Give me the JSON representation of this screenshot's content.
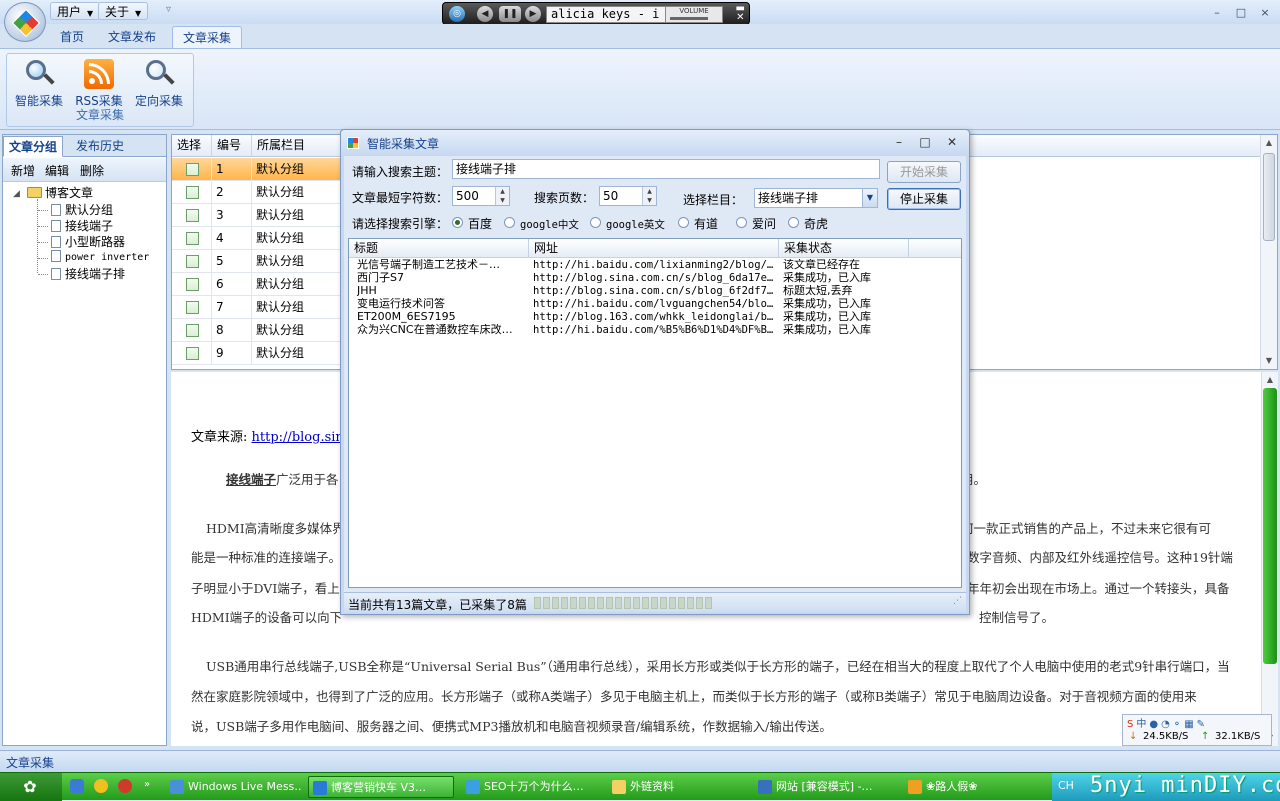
{
  "app": {
    "menus": [
      {
        "label": "用户"
      },
      {
        "label": "关于"
      }
    ],
    "window_controls": {
      "min": "–",
      "max": "□",
      "close": "×"
    }
  },
  "player": {
    "track": "alicia keys - i",
    "volume_label": "VOLUME",
    "volume_level": 0.75
  },
  "ribbon": {
    "tabs": [
      {
        "label": "首页"
      },
      {
        "label": "文章发布"
      },
      {
        "label": "文章采集"
      }
    ],
    "active_tab": "文章采集",
    "group_label": "文章采集",
    "buttons": [
      {
        "label": "智能采集",
        "icon": "magnifier-icon"
      },
      {
        "label": "RSS采集",
        "icon": "rss-icon"
      },
      {
        "label": "定向采集",
        "icon": "magnifier-icon"
      }
    ]
  },
  "left_panel": {
    "tabs": [
      {
        "label": "文章分组"
      },
      {
        "label": "发布历史"
      }
    ],
    "toolbar": [
      {
        "label": "新增"
      },
      {
        "label": "编辑"
      },
      {
        "label": "删除"
      }
    ],
    "tree": {
      "root": "博客文章",
      "children": [
        {
          "label": "默认分组"
        },
        {
          "label": "接线端子"
        },
        {
          "label": "小型断路器"
        },
        {
          "label": "power inverter"
        },
        {
          "label": "接线端子排"
        }
      ]
    }
  },
  "grid": {
    "columns": [
      "选择",
      "编号",
      "所属栏目"
    ],
    "rows": [
      {
        "id": "1",
        "group": "默认分组"
      },
      {
        "id": "2",
        "group": "默认分组"
      },
      {
        "id": "3",
        "group": "默认分组"
      },
      {
        "id": "4",
        "group": "默认分组"
      },
      {
        "id": "5",
        "group": "默认分组"
      },
      {
        "id": "6",
        "group": "默认分组"
      },
      {
        "id": "7",
        "group": "默认分组"
      },
      {
        "id": "8",
        "group": "默认分组"
      },
      {
        "id": "9",
        "group": "默认分组"
      }
    ]
  },
  "article": {
    "source_label": "文章来源:",
    "source_link": "http://blog.sina",
    "keyword": "接线端子",
    "lines": [
      "广泛用于各",
      "用。",
      "HDMI高清晰度多媒体界",
      "何一款正式销售的产品上，不过未来它很有可",
      "能是一种标准的连接端子。",
      "数字音频、内部及红外线遥控信号。这种19针端",
      "子明显小于DVI端子，看上",
      "年年初会出现在市场上。通过一个转接头，具备",
      "HDMI端子的设备可以向下",
      "控制信号了。",
      "USB通用串行总线端子,USB全称是“Universal Serial Bus”（通用串行总线），采用长方形或类似于长方形的端子，已经在相当大的程度上取代了个人电脑中使用的老式9针串行端口，当",
      "然在家庭影院领域中，也得到了广泛的应用。长方形端子（或称A类端子）多见于电脑主机上，而类似于长方形的端子（或称B类端子）常见于电脑周边设备。对于音视频方面的使用来",
      "说，USB端子多用作电脑间、服务器之间、便携式MP3播放机和电脑音视频录音/编辑系统，作数据输入/输出传送。"
    ]
  },
  "status_bar": {
    "text": "文章采集"
  },
  "net_monitor": {
    "down": "24.5KB/S",
    "up": "32.1KB/S"
  },
  "dialog": {
    "title": "智能采集文章",
    "topic_label": "请输入搜索主题：",
    "topic_value": "接线端子排",
    "start_button": "开始采集",
    "min_chars_label": "文章最短字符数：",
    "min_chars_value": "500",
    "pages_label": "搜索页数：",
    "pages_value": "50",
    "column_label": "选择栏目：",
    "column_value": "接线端子排",
    "stop_button": "停止采集",
    "engine_label": "请选择搜索引擎：",
    "engines": [
      {
        "label": "百度",
        "selected": true
      },
      {
        "label": "google中文",
        "selected": false
      },
      {
        "label": "google英文",
        "selected": false
      },
      {
        "label": "有道",
        "selected": false
      },
      {
        "label": "爱问",
        "selected": false
      },
      {
        "label": "奇虎",
        "selected": false
      }
    ],
    "list_columns": [
      "标题",
      "网址",
      "采集状态"
    ],
    "results": [
      {
        "title": "光信号端子制造工艺技术－…",
        "url": "http://hi.baidu.com/lixianming2/blog/…",
        "status": "该文章已经存在"
      },
      {
        "title": "西门子S7",
        "url": "http://blog.sina.com.cn/s/blog_6da17e…",
        "status": "采集成功，已入库"
      },
      {
        "title": "JHH",
        "url": "http://blog.sina.com.cn/s/blog_6f2df7…",
        "status": "标题太短,丢弃"
      },
      {
        "title": "变电运行技术问答",
        "url": "http://hi.baidu.com/lvguangchen54/blo…",
        "status": "采集成功，已入库"
      },
      {
        "title": "ET200M_6ES7195",
        "url": "http://blog.163.com/whkk_leidonglai/b…",
        "status": "采集成功，已入库"
      },
      {
        "title": "众为兴CNC在普通数控车床改…",
        "url": "http://hi.baidu.com/%B5%B6%D1%D4%DF%B…",
        "status": "采集成功，已入库"
      }
    ],
    "status_text": "当前共有13篇文章，已采集了8篇",
    "progress_fraction": 0
  },
  "taskbar": {
    "items": [
      {
        "label": "Windows Live Mess…",
        "active": false
      },
      {
        "label": "博客营销快车 V3…",
        "active": true
      },
      {
        "label": "SEO十万个为什么…",
        "active": false
      },
      {
        "label": "外链资料",
        "active": false
      },
      {
        "label": "网站 [兼容模式] -…",
        "active": false
      },
      {
        "label": "❀路人假❀",
        "active": false
      }
    ],
    "tray_lang": "CH",
    "watermark": "5nyi minDIY.com"
  }
}
